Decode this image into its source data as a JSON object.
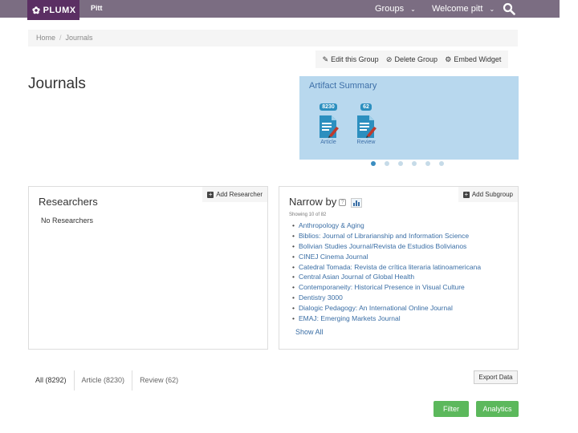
{
  "header": {
    "logo_text": "PLUMX",
    "org": "Pitt",
    "groups_label": "Groups",
    "welcome_label": "Welcome pitt",
    "brand_color": "#5b2f63",
    "bar_color": "#7b6d82"
  },
  "breadcrumb": {
    "home": "Home",
    "current": "Journals"
  },
  "actions": {
    "edit": "Edit this Group",
    "delete": "Delete Group",
    "embed": "Embed Widget"
  },
  "page": {
    "title": "Journals"
  },
  "summary": {
    "title": "Artifact Summary",
    "artifacts": [
      {
        "count": "8230",
        "label": "Article"
      },
      {
        "count": "62",
        "label": "Review"
      }
    ]
  },
  "researchers": {
    "title": "Researchers",
    "add_label": "Add Researcher",
    "empty_text": "No Researchers"
  },
  "narrow": {
    "title": "Narrow by",
    "add_label": "Add Subgroup",
    "showing": "Showing 10 of 82",
    "items": [
      "Anthropology & Aging",
      "Biblios: Journal of Librarianship and Information Science",
      "Bolivian Studies Journal/Revista de Estudios Bolivianos",
      "CINEJ Cinema Journal",
      "Catedral Tomada: Revista de crítica literaria latinoamericana",
      "Central Asian Journal of Global Health",
      "Contemporaneity: Historical Presence in Visual Culture",
      "Dentistry 3000",
      "Dialogic Pedagogy: An International Online Journal",
      "EMAJ: Emerging Markets Journal"
    ],
    "show_all": "Show All"
  },
  "tabs": [
    {
      "label": "All (8292)"
    },
    {
      "label": "Article (8230)"
    },
    {
      "label": "Review (62)"
    }
  ],
  "buttons": {
    "export": "Export Data",
    "filter": "Filter",
    "analytics": "Analytics"
  }
}
